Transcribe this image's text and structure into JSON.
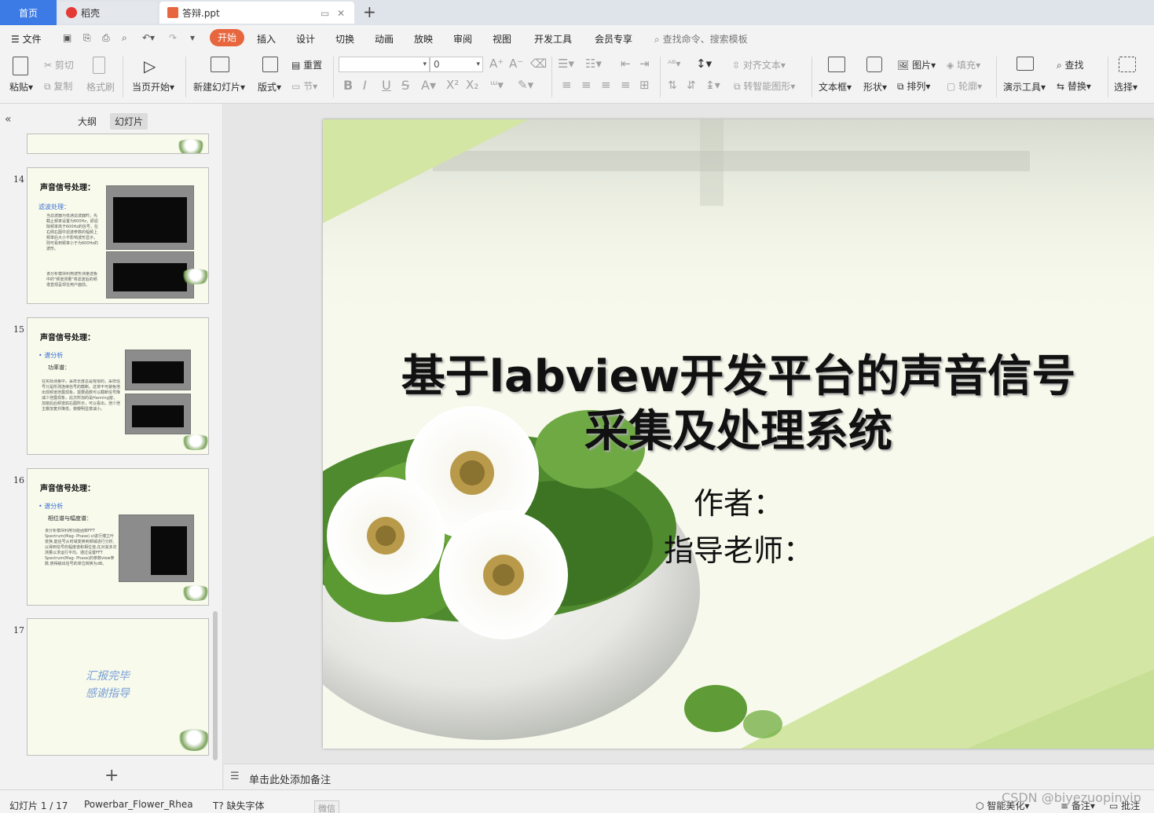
{
  "tabs": {
    "home": "首页",
    "daoke": "稻壳",
    "file": "答辩.ppt"
  },
  "menu": {
    "file": "文件",
    "items": [
      "开始",
      "插入",
      "设计",
      "切换",
      "动画",
      "放映",
      "审阅",
      "视图",
      "开发工具",
      "会员专享"
    ],
    "search": "查找命令、搜索模板"
  },
  "ribbon": {
    "paste": "粘贴",
    "cut": "剪切",
    "copy": "复制",
    "format_painter": "格式刷",
    "from_current": "当页开始",
    "new_slide": "新建幻灯片",
    "layout": "版式",
    "reset": "重置",
    "section": "节",
    "font_size": "0",
    "align_text": "对齐文本",
    "smart_shape": "转智能图形",
    "textbox": "文本框",
    "shape": "形状",
    "picture": "图片",
    "arrange": "排列",
    "fill": "填充",
    "outline": "轮廓",
    "presenter_tools": "演示工具",
    "find": "查找",
    "replace": "替换",
    "select": "选择"
  },
  "panel": {
    "outline_tab": "大纲",
    "slides_tab": "幻灯片"
  },
  "thumbnails": [
    {
      "num": "14",
      "title": "声音信号处理：",
      "subtitle": "滤波处理：",
      "text1": "当滤波器为低通滤波器时，先截止频率设置为600Hz，即滤除频率高于600Hz的信号，在右侧右图中滤波参数的幅频上频率后大小不影响波形显示，则可看到频率小于为600Hz的波形。",
      "text2": "该分析模块利用波形测量选板中的\"频谱测量\"将滤波后的频谱直观呈现在用户面前。"
    },
    {
      "num": "15",
      "title": "声音信号处理：",
      "subtitle": "• 谱分析",
      "heading": "功率谱：",
      "text1": "在实际测量中，采样长度总是有限的，采样信号只是所测连续信号的截断。这将不可避免地出现频谱泄露现象。需要函数可以截断信号降减少泄露现象，此次所加的是Hanning窗，加窗后后频谱如右图所示，可以看出，泄少泄主瓣加宽并降低，旁瓣明显衰减小。"
    },
    {
      "num": "16",
      "title": "声音信号处理：",
      "subtitle": "• 谱分析",
      "heading": "相位谱与幅度谱：",
      "text1": "该分析模块利用功能函数FFT Spectrum(Mag- Phase).vi进行傅立叶变换,能信号从时域变换到频域进行分析,以得到信号的幅度谱和相位谱,在对其多次测量以求运行平均。通过设置FFT Spectrum(Mag- Phase)的参数view参数,使得输出信号的单位转换为dB。"
    },
    {
      "num": "17",
      "line1": "汇报完毕",
      "line2": "感谢指导"
    }
  ],
  "slide": {
    "title_line1": "基于labview开发平台的声音信号",
    "title_line2": "采集及处理系统",
    "author": "作者：",
    "advisor": "指导老师："
  },
  "notes_placeholder": "单击此处添加备注",
  "status": {
    "slide_counter": "幻灯片 1 / 17",
    "theme": "Powerbar_Flower_Rhea",
    "missing_fonts": "缺失字体",
    "wechat": "微信",
    "smart_beautify": "智能美化",
    "notes": "备注",
    "comments": "批注",
    "watermark": "CSDN @biyezuopinvip"
  },
  "colors": {
    "accent": "#e8663d",
    "home_tab": "#3c7be6",
    "slide_green": "#d3e6a4"
  }
}
